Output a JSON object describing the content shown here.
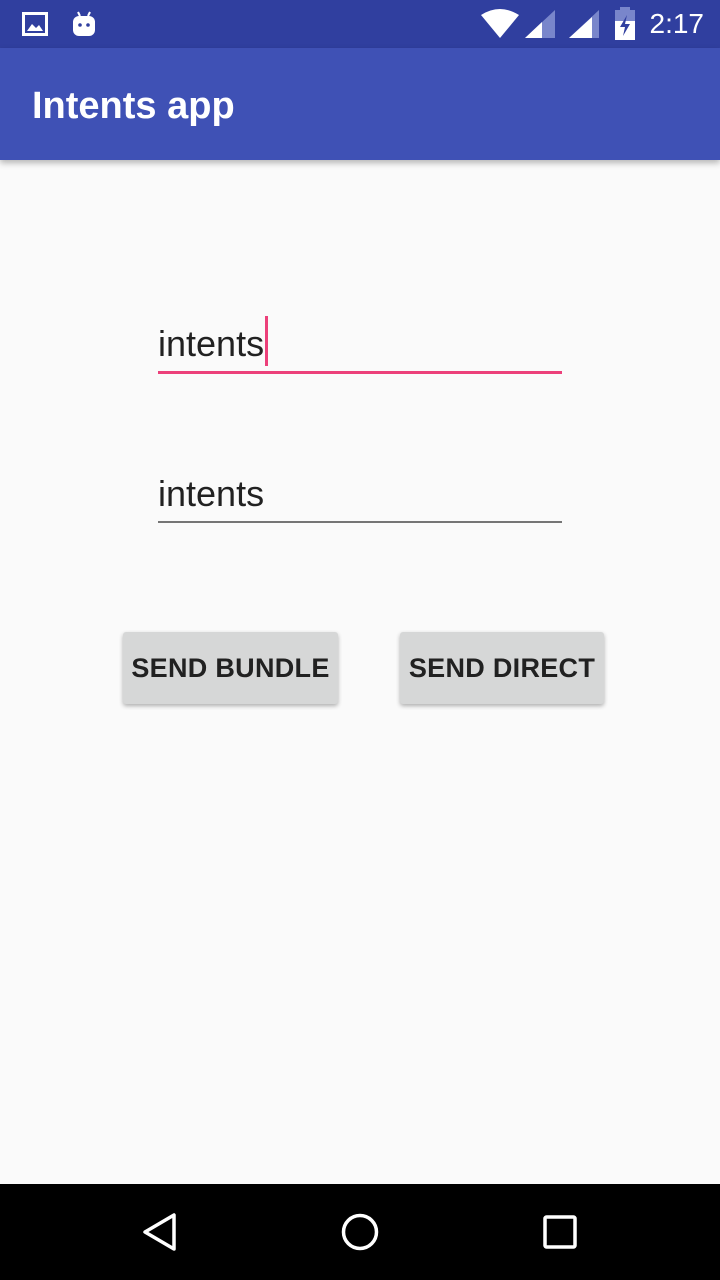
{
  "status_bar": {
    "time": "2:17",
    "icons": [
      "image-icon",
      "android-icon",
      "wifi-icon",
      "signal-icon",
      "signal-icon",
      "battery-charging-icon"
    ]
  },
  "app_bar": {
    "title": "Intents app"
  },
  "form": {
    "field1": {
      "value": "intents",
      "focused": true
    },
    "field2": {
      "value": "intents"
    }
  },
  "buttons": {
    "send_bundle": "SEND BUNDLE",
    "send_direct": "SEND DIRECT"
  },
  "nav_bar": {
    "icons": [
      "back-icon",
      "home-icon",
      "recents-icon"
    ]
  },
  "colors": {
    "status_bar": "#303f9f",
    "primary": "#3f51b5",
    "accent": "#ec407a",
    "background": "#fafafa",
    "button": "#d6d7d7"
  }
}
